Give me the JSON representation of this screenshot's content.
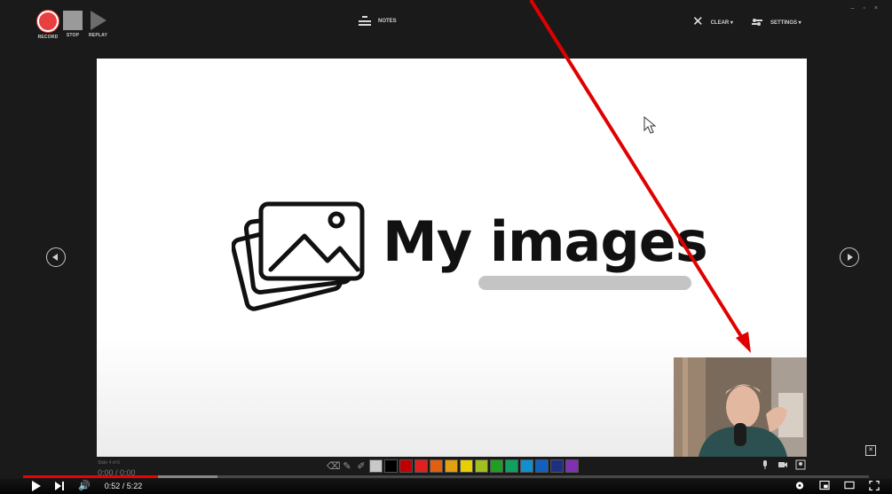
{
  "recorder": {
    "record_label": "RECORD",
    "stop_label": "STOP",
    "replay_label": "REPLAY",
    "notes_label": "NOTES",
    "clear_label": "CLEAR ▾",
    "settings_label": "SETTINGS ▾",
    "window_controls": [
      "–",
      "▫",
      "×"
    ]
  },
  "slide": {
    "title": "My images"
  },
  "status": {
    "slide_count": "Slide 4 of 6",
    "timer": "0:00 / 0:00"
  },
  "pen_colors": [
    "#c8c8c8",
    "#000000",
    "#c00000",
    "#e02020",
    "#e06010",
    "#e0a010",
    "#e8d000",
    "#a0c020",
    "#20a020",
    "#10a060",
    "#1090d0",
    "#1060c0",
    "#203080",
    "#8030b0"
  ],
  "player": {
    "current_time": "0:52",
    "duration": "5:22",
    "time_display": "0:52 / 5:22",
    "played_fraction": 0.16,
    "buffered_fraction": 0.23
  },
  "icons": {
    "annotation_arrow_color": "#e00000",
    "accent_red": "#e84040"
  }
}
